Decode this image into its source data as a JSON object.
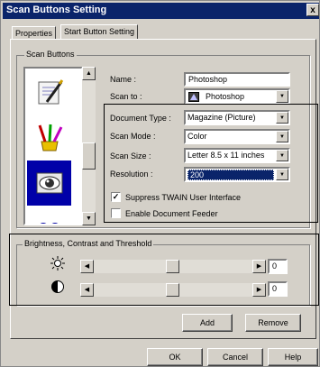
{
  "window": {
    "title": "Scan Buttons Setting",
    "close_glyph": "x"
  },
  "tabs": [
    {
      "label": "Properties"
    },
    {
      "label": "Start Button Setting"
    }
  ],
  "scan_buttons": {
    "group_label": "Scan Buttons",
    "name_label": "Name :",
    "name_value": "Photoshop",
    "scan_to_label": "Scan to :",
    "scan_to_value": "Photoshop",
    "document_type_label": "Document Type :",
    "document_type_value": "Magazine (Picture)",
    "scan_mode_label": "Scan Mode :",
    "scan_mode_value": "Color",
    "scan_size_label": "Scan Size :",
    "scan_size_value": "Letter 8.5 x 11 inches",
    "resolution_label": "Resolution :",
    "resolution_value": "200",
    "suppress_twain_label": "Suppress TWAIN User Interface",
    "suppress_twain_checked": true,
    "enable_feeder_label": "Enable Document Feeder",
    "enable_feeder_checked": false,
    "list_icons": [
      "document-pen-icon",
      "paint-brushes-icon",
      "eye-icon",
      "glasses-icon"
    ],
    "selected_index": 2
  },
  "adjustments": {
    "group_label": "Brightness, Contrast and Threshold",
    "brightness_value": "0",
    "contrast_value": "0",
    "brightness_level": 0.5,
    "contrast_level": 0.5
  },
  "buttons": {
    "add": "Add",
    "remove": "Remove",
    "ok": "OK",
    "cancel": "Cancel",
    "help": "Help"
  },
  "colors": {
    "titlebar": "#0a246a",
    "selection": "#0000a8",
    "face": "#d4d0c8"
  }
}
